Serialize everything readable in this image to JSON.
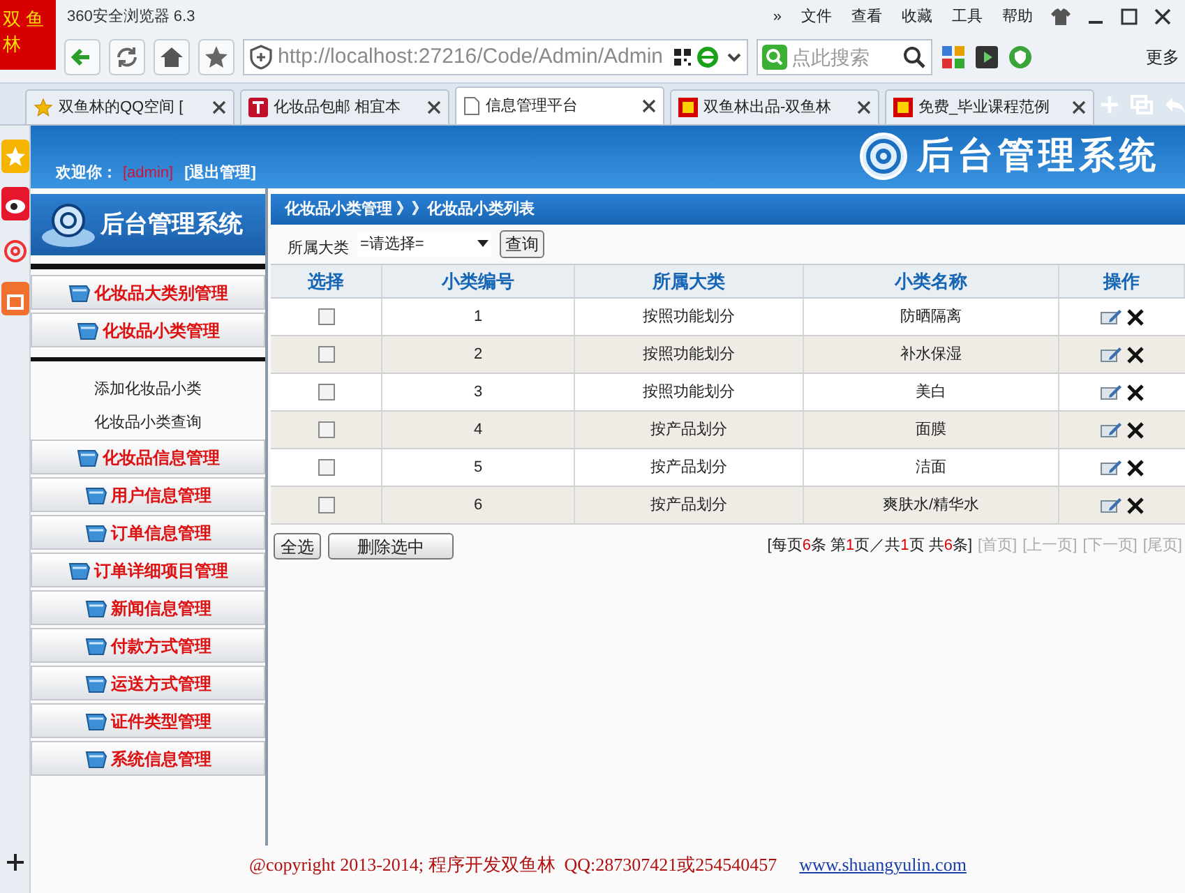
{
  "browser": {
    "logo_lines": [
      "双 鱼",
      "林"
    ],
    "title": "360安全浏览器 6.3",
    "menu": [
      "»",
      "文件",
      "查看",
      "收藏",
      "工具",
      "帮助"
    ],
    "url": "http://localhost:27216/Code/Admin/Admin",
    "search_placeholder": "点此搜索",
    "more": "更多",
    "tabs": [
      {
        "label": "双鱼林的QQ空间 [",
        "selected": false,
        "kind": "star"
      },
      {
        "label": "化妆品包邮 相宜本",
        "selected": false,
        "kind": "letter"
      },
      {
        "label": "信息管理平台",
        "selected": true,
        "kind": "page"
      },
      {
        "label": "双鱼林出品-双鱼林",
        "selected": false,
        "kind": "logo"
      },
      {
        "label": "免费_毕业课程范例",
        "selected": false,
        "kind": "logo"
      }
    ]
  },
  "header": {
    "welcome": "欢迎你：",
    "user": "[admin]",
    "logout": "[退出管理]",
    "title": "后台管理系统"
  },
  "sidebar": {
    "title": "后台管理系统",
    "items": [
      {
        "kind": "section",
        "label": "化妆品大类别管理"
      },
      {
        "kind": "section",
        "label": "化妆品小类管理"
      },
      {
        "kind": "divider"
      },
      {
        "kind": "link",
        "label": "添加化妆品小类"
      },
      {
        "kind": "link",
        "label": "化妆品小类查询"
      },
      {
        "kind": "section",
        "label": "化妆品信息管理"
      },
      {
        "kind": "section",
        "label": "用户信息管理"
      },
      {
        "kind": "section",
        "label": "订单信息管理"
      },
      {
        "kind": "section",
        "label": "订单详细项目管理"
      },
      {
        "kind": "section",
        "label": "新闻信息管理"
      },
      {
        "kind": "section",
        "label": "付款方式管理"
      },
      {
        "kind": "section",
        "label": "运送方式管理"
      },
      {
        "kind": "section",
        "label": "证件类型管理"
      },
      {
        "kind": "section",
        "label": "系统信息管理"
      }
    ]
  },
  "breadcrumb": "化妆品小类管理 》》化妆品小类列表",
  "filter": {
    "label": "所属大类",
    "select": "=请选择=",
    "button": "查询"
  },
  "table": {
    "columns": [
      "选择",
      "小类编号",
      "所属大类",
      "小类名称",
      "操作"
    ],
    "rows": [
      {
        "checked": false,
        "id": "1",
        "category": "按照功能划分",
        "name": "防晒隔离"
      },
      {
        "checked": false,
        "id": "2",
        "category": "按照功能划分",
        "name": "补水保湿"
      },
      {
        "checked": false,
        "id": "3",
        "category": "按照功能划分",
        "name": "美白"
      },
      {
        "checked": false,
        "id": "4",
        "category": "按产品划分",
        "name": "面膜"
      },
      {
        "checked": false,
        "id": "5",
        "category": "按产品划分",
        "name": "洁面"
      },
      {
        "checked": false,
        "id": "6",
        "category": "按产品划分",
        "name": "爽肤水/精华水"
      }
    ]
  },
  "buttons": [
    "全选",
    "删除选中"
  ],
  "pagination": {
    "summary": "[每页**6**条 第**1**页／共**1**页 共**6**条]",
    "links": [
      {
        "label": "[首页]",
        "disabled": true
      },
      {
        "label": "[上一页]",
        "disabled": true
      },
      {
        "label": "[下一页]",
        "disabled": true
      },
      {
        "label": "[尾页]",
        "disabled": true
      }
    ]
  },
  "footer": {
    "text": "@copyright 2013-2014; 程序开发双鱼林  QQ:287307421或254540457",
    "link": "www.shuangyulin.com"
  }
}
